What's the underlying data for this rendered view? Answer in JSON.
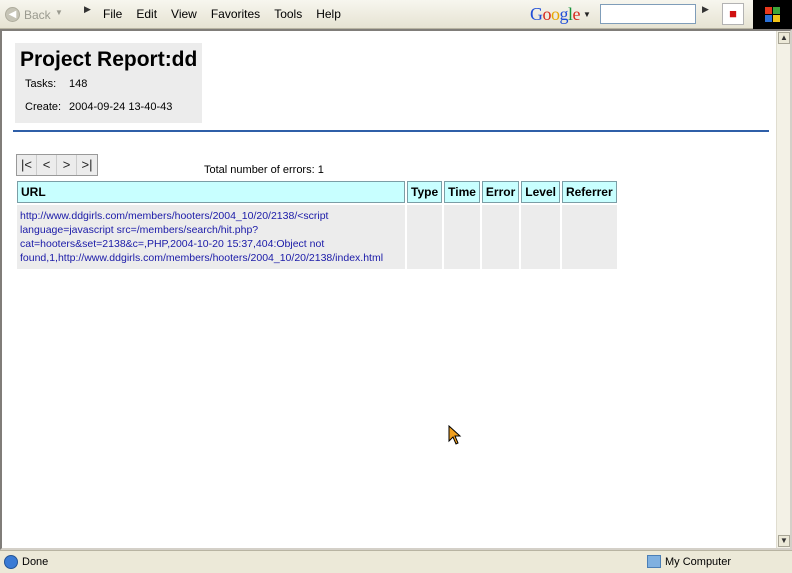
{
  "toolbar": {
    "back_label": "Back",
    "menus": [
      "File",
      "Edit",
      "View",
      "Favorites",
      "Tools",
      "Help"
    ],
    "google_letters": [
      "G",
      "o",
      "o",
      "g",
      "l",
      "e"
    ],
    "search_value": ""
  },
  "report": {
    "title": "Project Report:dd",
    "tasks_label": "Tasks:",
    "tasks_value": "148",
    "create_label": "Create:",
    "create_value": "2004-09-24 13-40-43"
  },
  "pager": {
    "first": "|<",
    "prev": "<",
    "next": ">",
    "last": ">|"
  },
  "errors": {
    "total_label": "Total number of errors: 1",
    "columns": [
      "URL",
      "Type",
      "Time",
      "Error",
      "Level",
      "Referrer"
    ],
    "rows": [
      {
        "url_lines": [
          "http://www.ddgirls.com/members/hooters/2004_10/20/2138/<script",
          "language=javascript src=/members/search/hit.php?",
          "cat=hooters&set=2138&c=,PHP,2004-10-20 15:37,404:Object not",
          "found,1,http://www.ddgirls.com/members/hooters/2004_10/20/2138/index.html"
        ],
        "type": "",
        "time": "",
        "error": "",
        "level": "",
        "referrer": ""
      }
    ]
  },
  "status": {
    "text": "Done",
    "zone": "My Computer"
  },
  "colors": {
    "header_bg": "#c8ffff",
    "divider": "#2f5fa8",
    "link": "#1a1aa8"
  }
}
